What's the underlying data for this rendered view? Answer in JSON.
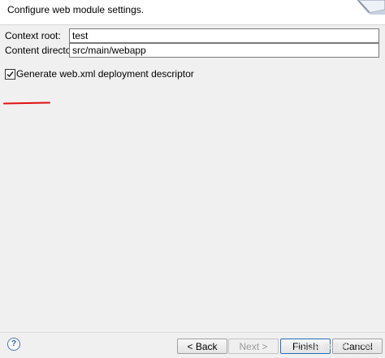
{
  "header": {
    "title": "Configure web module settings."
  },
  "form": {
    "context_root": {
      "label": "Context root:",
      "value": "test"
    },
    "content_directory": {
      "label": "Content directory:",
      "value": "src/main/webapp"
    },
    "generate_descriptor": {
      "label": "Generate web.xml deployment descriptor",
      "checked": true
    }
  },
  "footer": {
    "help_glyph": "?",
    "back_label": "< Back",
    "next_label": "Next >",
    "finish_label": "Finish",
    "cancel_label": "Cancel"
  },
  "watermark": {
    "text": "CSDN @은지 · 반은타"
  },
  "colors": {
    "annotation_red": "#e01010",
    "default_button_border": "#2a6fb8"
  },
  "icons": {
    "header_art": "wizard-banner-icon",
    "help": "help-icon",
    "checkbox": "checkmark-icon"
  }
}
